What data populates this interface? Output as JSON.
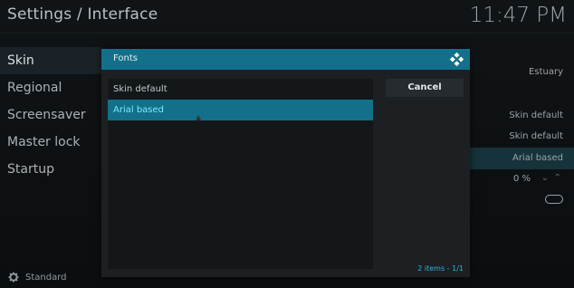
{
  "header": {
    "title": "Settings / Interface",
    "clock": "11:47 PM"
  },
  "menu": {
    "items": [
      {
        "label": "Skin",
        "active": true
      },
      {
        "label": "Regional",
        "active": false
      },
      {
        "label": "Screensaver",
        "active": false
      },
      {
        "label": "Master lock",
        "active": false
      },
      {
        "label": "Startup",
        "active": false
      }
    ]
  },
  "right_values": {
    "skin_value": "Estuary",
    "value1": "Skin default",
    "value2": "Skin default",
    "value3": "Arial based",
    "zoom": "0 %"
  },
  "footer": {
    "level_label": "Standard",
    "gear_icon": "gear-icon"
  },
  "dialog": {
    "title": "Fonts",
    "logo_icon": "kodi-logo-icon",
    "items": [
      {
        "label": "Skin default",
        "selected": false
      },
      {
        "label": "Arial based",
        "selected": true
      }
    ],
    "cancel_label": "Cancel",
    "count_items": "2 items - ",
    "count_page": "1/1"
  },
  "colors": {
    "accent": "#12708a",
    "selected_text": "#7fe7ff"
  }
}
